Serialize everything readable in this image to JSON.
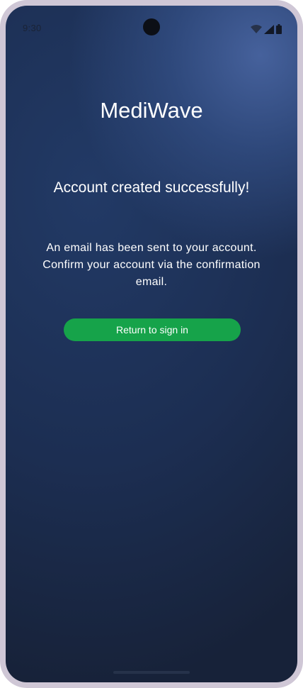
{
  "status_bar": {
    "time": "9:30",
    "icons": [
      "wifi-icon",
      "cellular-signal-icon",
      "battery-icon"
    ]
  },
  "app": {
    "title": "MediWave"
  },
  "content": {
    "heading": "Account created successfully!",
    "message": "An email has been sent to your account. Confirm your account via the confirmation email."
  },
  "actions": {
    "return_label": "Return to sign in"
  },
  "colors": {
    "button": "#16a34a",
    "background_dark": "#172239",
    "background_light": "#4864a0",
    "frame": "#cfc7d6"
  }
}
